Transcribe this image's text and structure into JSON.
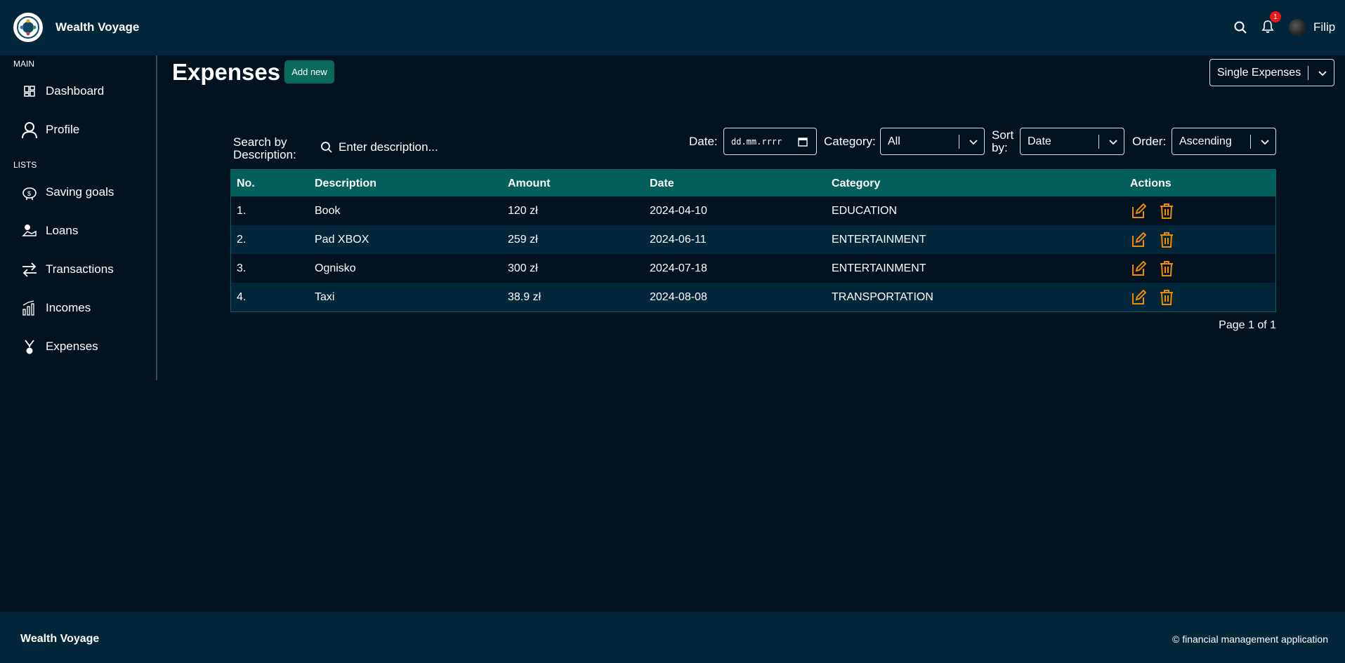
{
  "header": {
    "brand": "Wealth Voyage",
    "notification_count": "1",
    "user_name": "Filip"
  },
  "sidebar": {
    "main_label": "MAIN",
    "lists_label": "LISTS",
    "items": [
      {
        "label": "Dashboard",
        "icon": "dashboard-icon"
      },
      {
        "label": "Profile",
        "icon": "user-icon"
      },
      {
        "label": "Saving goals",
        "icon": "piggy-bank-icon"
      },
      {
        "label": "Loans",
        "icon": "loan-icon"
      },
      {
        "label": "Transactions",
        "icon": "transfer-arrows-icon"
      },
      {
        "label": "Incomes",
        "icon": "bar-chart-icon"
      },
      {
        "label": "Expenses",
        "icon": "expense-icon"
      }
    ]
  },
  "main": {
    "title": "Expenses",
    "add_label": "Add new",
    "view_select": "Single Expenses",
    "filters": {
      "search_label": "Search by Description:",
      "search_placeholder": "Enter description...",
      "date_label": "Date:",
      "date_placeholder": "dd.mm.rrrr",
      "category_label": "Category:",
      "category_value": "All",
      "sort_label": "Sort by:",
      "sort_value": "Date",
      "order_label": "Order:",
      "order_value": "Ascending"
    },
    "table": {
      "headers": {
        "no": "No.",
        "description": "Description",
        "amount": "Amount",
        "date": "Date",
        "category": "Category",
        "actions": "Actions"
      },
      "rows": [
        {
          "no": "1.",
          "description": "Book",
          "amount": "120 zł",
          "date": "2024-04-10",
          "category": "EDUCATION"
        },
        {
          "no": "2.",
          "description": "Pad XBOX",
          "amount": "259 zł",
          "date": "2024-06-11",
          "category": "ENTERTAINMENT"
        },
        {
          "no": "3.",
          "description": "Ognisko",
          "amount": "300 zł",
          "date": "2024-07-18",
          "category": "ENTERTAINMENT"
        },
        {
          "no": "4.",
          "description": "Taxi",
          "amount": "38.9 zł",
          "date": "2024-08-08",
          "category": "TRANSPORTATION"
        }
      ]
    },
    "pagination": "Page 1 of 1"
  },
  "footer": {
    "brand": "Wealth Voyage",
    "copyright": "© financial management application"
  },
  "colors": {
    "background": "#02131f",
    "header": "#02263a",
    "table_header": "#035f5a",
    "accent_button": "#0b6b5b",
    "action_icon": "#f08a00",
    "badge": "#e81818"
  }
}
